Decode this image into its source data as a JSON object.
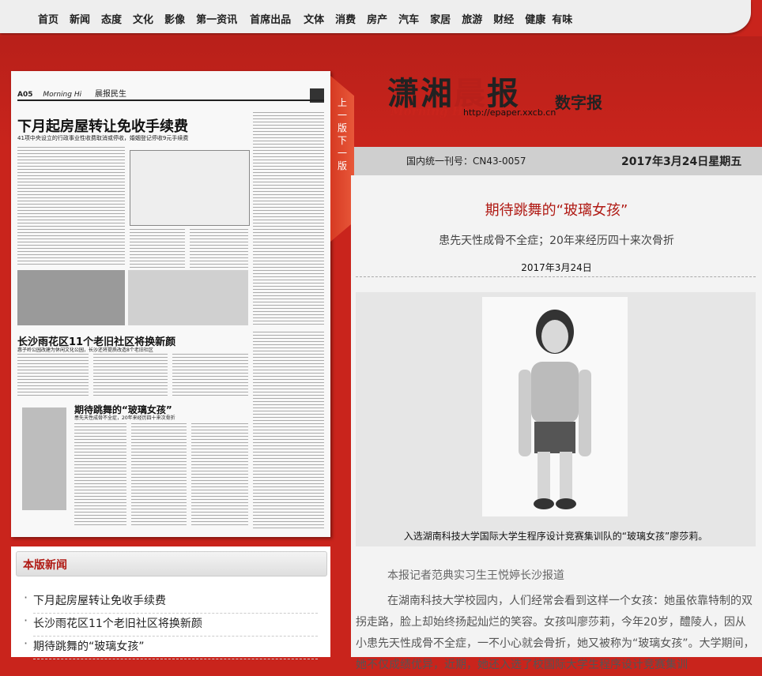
{
  "nav": {
    "items": [
      "首页",
      "新闻",
      "态度",
      "文化",
      "影像",
      "第一资讯",
      "首席出品",
      "文体",
      "消费",
      "房产",
      "汽车",
      "家居",
      "旅游",
      "财经",
      "健康",
      "有味"
    ]
  },
  "masthead": {
    "title_part1": "潇湘",
    "title_part2": "晨",
    "title_part3": "报",
    "english": "Morning Hi",
    "url": "http://epaper.xxcb.cn",
    "digital": "数字报"
  },
  "info": {
    "issn": "国内统一刊号：CN43-0057",
    "date": "2017年3月24日星期五"
  },
  "page_nav": {
    "prev": "上一版",
    "next": "下一版"
  },
  "paper": {
    "page_no": "A05",
    "brand": "Morning Hi",
    "section": "晨报民生",
    "headline1": "下月起房屋转让免收手续费",
    "sub1": "41项中央设立的行政事业性收费取消或停收，婚姻登记停收9元手续费",
    "headline2": "长沙雨花区11个老旧社区将换新颜",
    "sub2": "惠子岭公园改建为休闲文化公园，长沙还将提质改造8个老旧社区",
    "headline3": "期待跳舞的“玻璃女孩”",
    "sub3": "患先天性成骨不全症，20年来经历四十来次骨折"
  },
  "news_panel": {
    "heading": "本版新闻",
    "items": [
      "下月起房屋转让免收手续费",
      "长沙雨花区11个老旧社区将换新颜",
      "期待跳舞的“玻璃女孩”"
    ]
  },
  "article": {
    "title": "期待跳舞的“玻璃女孩”",
    "subtitle": "患先天性成骨不全症；20年来经历四十来次骨折",
    "date": "2017年3月24日",
    "caption": "入选湖南科技大学国际大学生程序设计竞赛集训队的“玻璃女孩”廖莎莉。",
    "byline": "本报记者范典实习生王悦婷长沙报道",
    "body": "在湖南科技大学校园内，人们经常会看到这样一个女孩：她虽依靠特制的双拐走路，脸上却始终扬起灿烂的笑容。女孩叫廖莎莉，今年20岁，醴陵人，因从小患先天性成骨不全症，一不小心就会骨折，她又被称为“玻璃女孩”。大学期间，她不仅成绩优异，近期，她还入选了校国际大学生程序设计竞赛集训"
  }
}
